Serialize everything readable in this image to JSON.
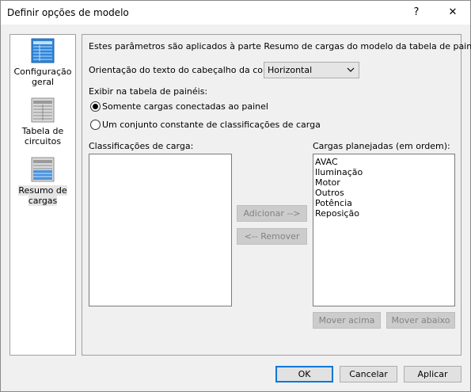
{
  "dialog": {
    "title": "Definir opções de modelo",
    "help": "?",
    "close": "✕"
  },
  "nav": {
    "items": [
      {
        "label1": "Configuração",
        "label2": "geral"
      },
      {
        "label1": "Tabela de",
        "label2": "circuitos"
      },
      {
        "label1": "Resumo de",
        "label2": "cargas"
      }
    ]
  },
  "panel": {
    "description": "Estes parâmetros são aplicados à parte Resumo de cargas do modelo da tabela de painéis.",
    "orientation_label": "Orientação do texto do cabeçalho da coluna:",
    "orientation_value": "Horizontal",
    "show_label": "Exibir na tabela de painéis:",
    "radio_connected": "Somente cargas conectadas ao painel",
    "radio_constant": "Um conjunto constante de classificações de carga",
    "classifications_label": "Classificações de carga:",
    "planned_label": "Cargas planejadas (em ordem):",
    "planned_items": [
      "AVAC",
      "Iluminação",
      "Motor",
      "Outros",
      "Potência",
      "Reposição"
    ],
    "add_button": "Adicionar -->",
    "remove_button": "<-- Remover",
    "move_up_button": "Mover acima",
    "move_down_button": "Mover abaixo"
  },
  "footer": {
    "ok": "OK",
    "cancel": "Cancelar",
    "apply": "Aplicar"
  }
}
